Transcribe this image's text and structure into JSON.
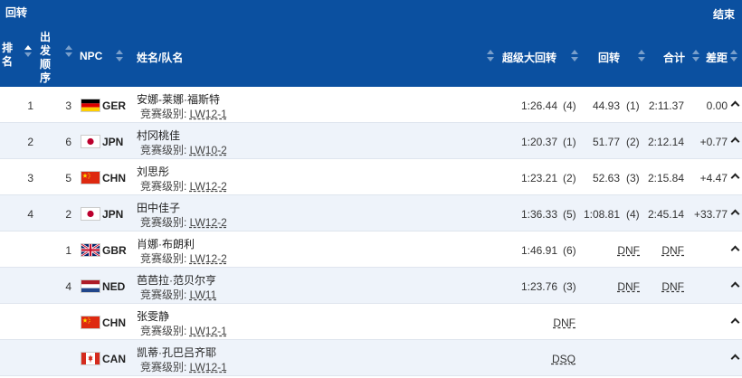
{
  "header": {
    "title": "回转",
    "action": "结束"
  },
  "columns": {
    "rank": "排名",
    "start": "出发顺序",
    "npc": "NPC",
    "name": "姓名/队名",
    "superg": "超级大回转",
    "slalom": "回转",
    "total": "合计",
    "diff": "差距"
  },
  "class_label": "竞赛级别: ",
  "rows": [
    {
      "rank": "1",
      "start": "3",
      "npc": "GER",
      "flag": "ger",
      "name": "安娜-莱娜·福斯特",
      "cls": "LW12-1",
      "superg": "1:26.44",
      "superg_r": "(4)",
      "slalom": "44.93",
      "slalom_r": "(1)",
      "total": "2:11.37",
      "diff": "0.00"
    },
    {
      "rank": "2",
      "start": "6",
      "npc": "JPN",
      "flag": "jpn",
      "name": "村冈桃佳",
      "cls": "LW10-2",
      "superg": "1:20.37",
      "superg_r": "(1)",
      "slalom": "51.77",
      "slalom_r": "(2)",
      "total": "2:12.14",
      "diff": "+0.77"
    },
    {
      "rank": "3",
      "start": "5",
      "npc": "CHN",
      "flag": "chn",
      "name": "刘思彤",
      "cls": "LW12-2",
      "superg": "1:23.21",
      "superg_r": "(2)",
      "slalom": "52.63",
      "slalom_r": "(3)",
      "total": "2:15.84",
      "diff": "+4.47"
    },
    {
      "rank": "4",
      "start": "2",
      "npc": "JPN",
      "flag": "jpn",
      "name": "田中佳子",
      "cls": "LW12-2",
      "superg": "1:36.33",
      "superg_r": "(5)",
      "slalom": "1:08.81",
      "slalom_r": "(4)",
      "total": "2:45.14",
      "diff": "+33.77"
    },
    {
      "rank": "",
      "start": "1",
      "npc": "GBR",
      "flag": "gbr",
      "name": "肖娜·布朗利",
      "cls": "LW12-2",
      "superg": "1:46.91",
      "superg_r": "(6)",
      "slalom": "DNF",
      "slalom_r": "",
      "total": "DNF",
      "diff": ""
    },
    {
      "rank": "",
      "start": "4",
      "npc": "NED",
      "flag": "ned",
      "name": "芭芭拉·范贝尔亨",
      "cls": "LW11",
      "superg": "1:23.76",
      "superg_r": "(3)",
      "slalom": "DNF",
      "slalom_r": "",
      "total": "DNF",
      "diff": ""
    },
    {
      "rank": "",
      "start": "",
      "npc": "CHN",
      "flag": "chn",
      "name": "张雯静",
      "cls": "LW12-1",
      "superg": "DNF",
      "superg_r": "",
      "slalom": "",
      "slalom_r": "",
      "total": "",
      "diff": ""
    },
    {
      "rank": "",
      "start": "",
      "npc": "CAN",
      "flag": "can",
      "name": "凯蒂·孔巴吕齐耶",
      "cls": "LW12-1",
      "superg": "DSQ",
      "superg_r": "",
      "slalom": "",
      "slalom_r": "",
      "total": "",
      "diff": ""
    }
  ]
}
